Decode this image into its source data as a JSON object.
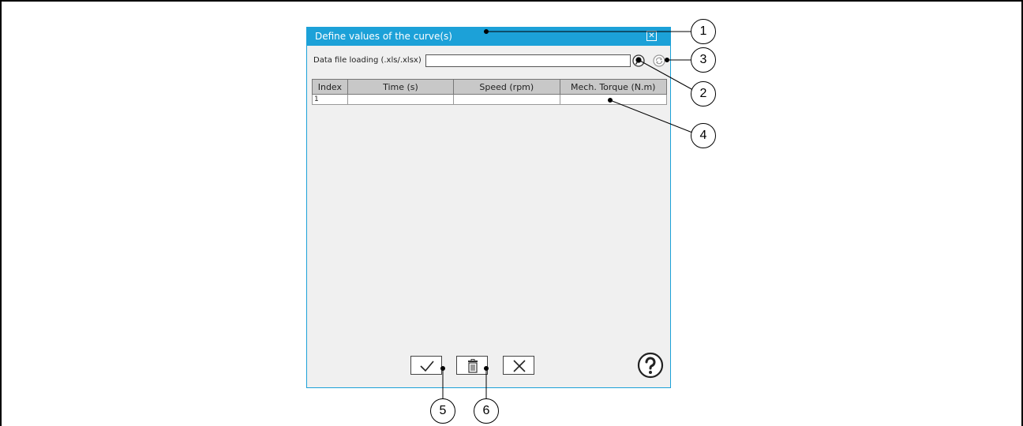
{
  "dialog": {
    "title": "Define values of the curve(s)",
    "close_icon": "close-icon",
    "file_loading": {
      "label": "Data file loading (.xls/.xlsx)",
      "value": "",
      "browse_icon": "browse-file-icon",
      "refresh_icon": "refresh-icon"
    },
    "table": {
      "columns": [
        "Index",
        "Time (s)",
        "Speed (rpm)",
        "Mech. Torque (N.m)"
      ],
      "rows": [
        [
          "1",
          "",
          "",
          ""
        ]
      ]
    },
    "buttons": {
      "validate_icon": "checkmark-icon",
      "delete_icon": "trash-icon",
      "cancel_icon": "cross-icon",
      "help_icon": "help-icon"
    }
  },
  "callouts": [
    "1",
    "2",
    "3",
    "4",
    "5",
    "6"
  ],
  "colors": {
    "titlebar": "#1ca1d8",
    "dialog_bg": "#f0f0f0",
    "header_bg": "#c8c8c8"
  }
}
